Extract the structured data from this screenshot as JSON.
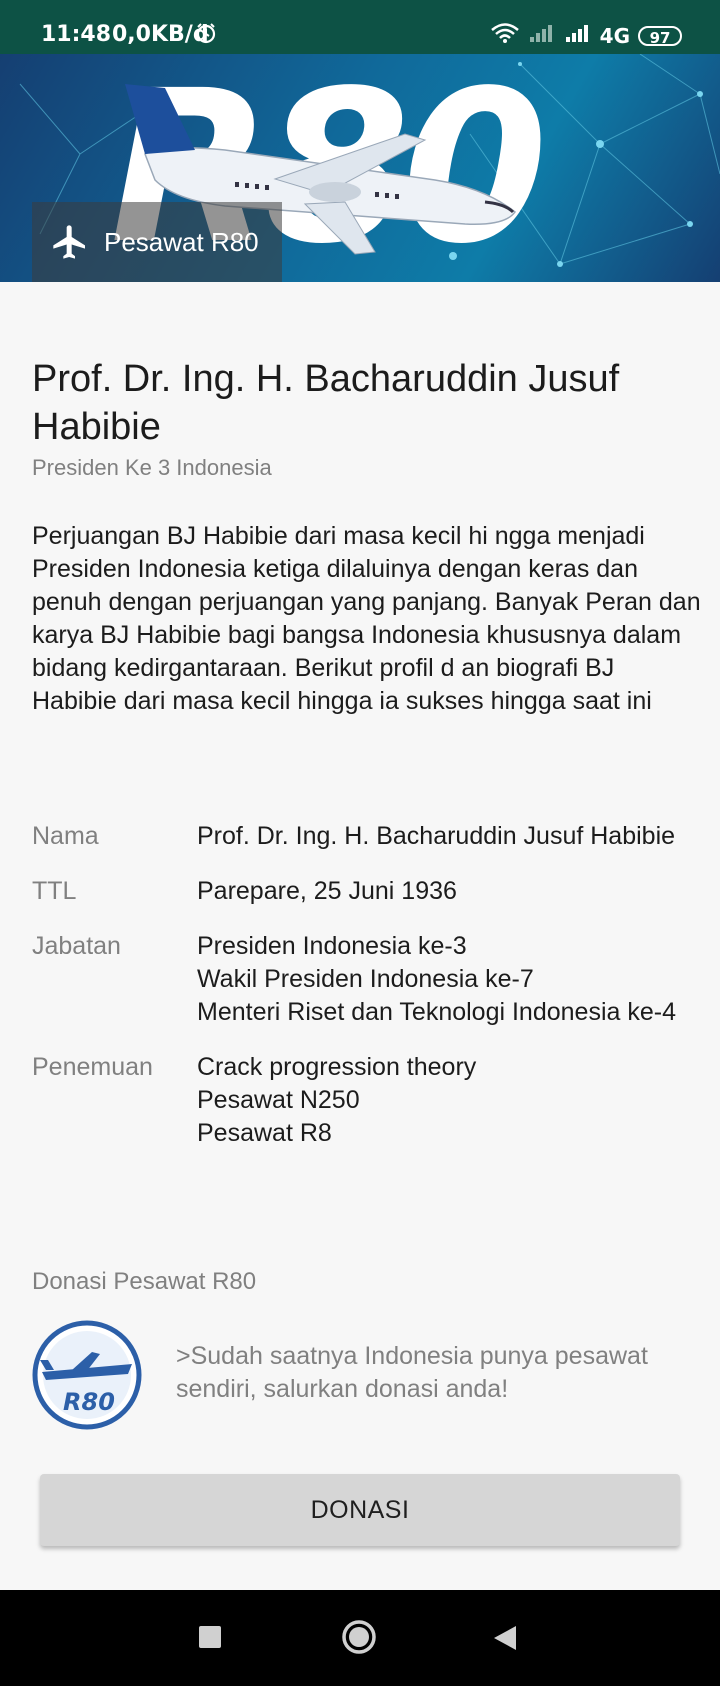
{
  "status_bar": {
    "time": "11:48",
    "network_speed": "0,0KB/d",
    "network_type": "4G",
    "battery": "97"
  },
  "header": {
    "logo_text": "R80",
    "title": "Pesawat R80"
  },
  "profile": {
    "name": "Prof. Dr. Ing. H. Bacharuddin Jusuf Habibie",
    "subtitle": "Presiden Ke 3 Indonesia",
    "bio": "Perjuangan BJ Habibie dari masa kecil hi ngga menjadi Presiden Indonesia ketiga dilaluinya dengan keras dan penuh dengan perjuangan yang panjang. Banyak Peran dan karya BJ Habibie bagi bangsa Indonesia khususnya dalam bidang kedirgantaraan. Berikut profil d an biografi BJ Habibie dari masa kecil hingga ia sukses hingga saat ini"
  },
  "info": [
    {
      "label": "Nama",
      "value": "Prof. Dr. Ing. H. Bacharuddin Jusuf Habibie"
    },
    {
      "label": "TTL",
      "value": "Parepare, 25 Juni 1936"
    },
    {
      "label": "Jabatan",
      "value": "Presiden Indonesia ke-3\n Wakil Presiden Indonesia ke-7\n Menteri Riset dan Teknologi Indonesia ke-4"
    },
    {
      "label": "Penemuan",
      "value": "Crack progression theory\n Pesawat N250\n Pesawat R8"
    }
  ],
  "donasi": {
    "title": "Donasi Pesawat R80",
    "logo_text": "R80",
    "message": ">Sudah saatnya Indonesia punya pesawat sendiri, salurkan donasi anda!",
    "button_label": "DONASI"
  },
  "colors": {
    "status_bar": "#0d5245",
    "page_background": "#f7f7f7",
    "button_background": "#d6d6d6"
  }
}
